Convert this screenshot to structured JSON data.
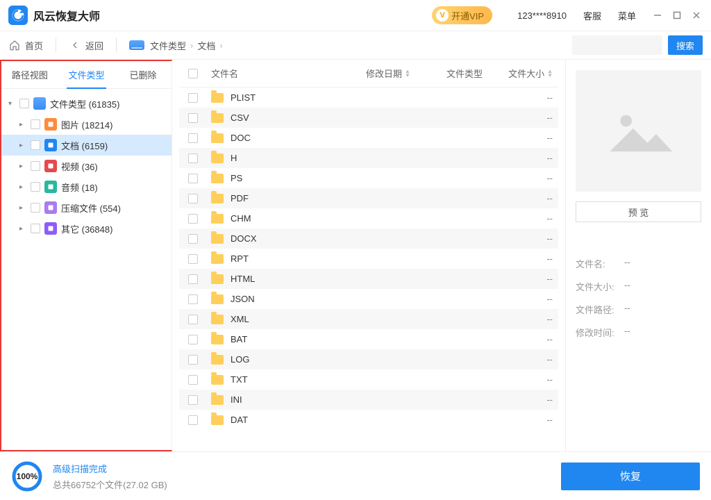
{
  "titlebar": {
    "app_name": "风云恢复大师",
    "vip_label": "开通VIP",
    "user_id": "123****8910",
    "support": "客服",
    "menu": "菜单"
  },
  "toolbar": {
    "home": "首页",
    "back": "返回",
    "breadcrumb": [
      "文件类型",
      "文档"
    ],
    "search_btn": "搜索"
  },
  "sidebar": {
    "tabs": {
      "path": "路径视图",
      "type": "文件类型",
      "deleted": "已删除"
    },
    "root": {
      "label": "文件类型 (61835)"
    },
    "items": [
      {
        "label": "图片 (18214)",
        "icon": "ic-img"
      },
      {
        "label": "文档 (6159)",
        "icon": "ic-doc",
        "selected": true
      },
      {
        "label": "视频 (36)",
        "icon": "ic-vid"
      },
      {
        "label": "音频 (18)",
        "icon": "ic-aud"
      },
      {
        "label": "压缩文件 (554)",
        "icon": "ic-zip"
      },
      {
        "label": "其它 (36848)",
        "icon": "ic-other"
      }
    ]
  },
  "table": {
    "headers": {
      "name": "文件名",
      "date": "修改日期",
      "type": "文件类型",
      "size": "文件大小"
    },
    "rows": [
      {
        "name": "PLIST",
        "size": "--"
      },
      {
        "name": "CSV",
        "size": "--"
      },
      {
        "name": "DOC",
        "size": "--"
      },
      {
        "name": "H",
        "size": "--"
      },
      {
        "name": "PS",
        "size": "--"
      },
      {
        "name": "PDF",
        "size": "--"
      },
      {
        "name": "CHM",
        "size": "--"
      },
      {
        "name": "DOCX",
        "size": "--"
      },
      {
        "name": "RPT",
        "size": "--"
      },
      {
        "name": "HTML",
        "size": "--"
      },
      {
        "name": "JSON",
        "size": "--"
      },
      {
        "name": "XML",
        "size": "--"
      },
      {
        "name": "BAT",
        "size": "--"
      },
      {
        "name": "LOG",
        "size": "--"
      },
      {
        "name": "TXT",
        "size": "--"
      },
      {
        "name": "INI",
        "size": "--"
      },
      {
        "name": "DAT",
        "size": "--"
      }
    ]
  },
  "rpanel": {
    "preview_btn": "预 览",
    "meta": {
      "name_label": "文件名:",
      "name_val": "--",
      "size_label": "文件大小:",
      "size_val": "--",
      "path_label": "文件路径:",
      "path_val": "--",
      "mtime_label": "修改时间:",
      "mtime_val": "--"
    }
  },
  "footer": {
    "progress_pct": "100%",
    "line1": "高级扫描完成",
    "line2": "总共66752个文件(27.02 GB)",
    "recover": "恢复"
  }
}
